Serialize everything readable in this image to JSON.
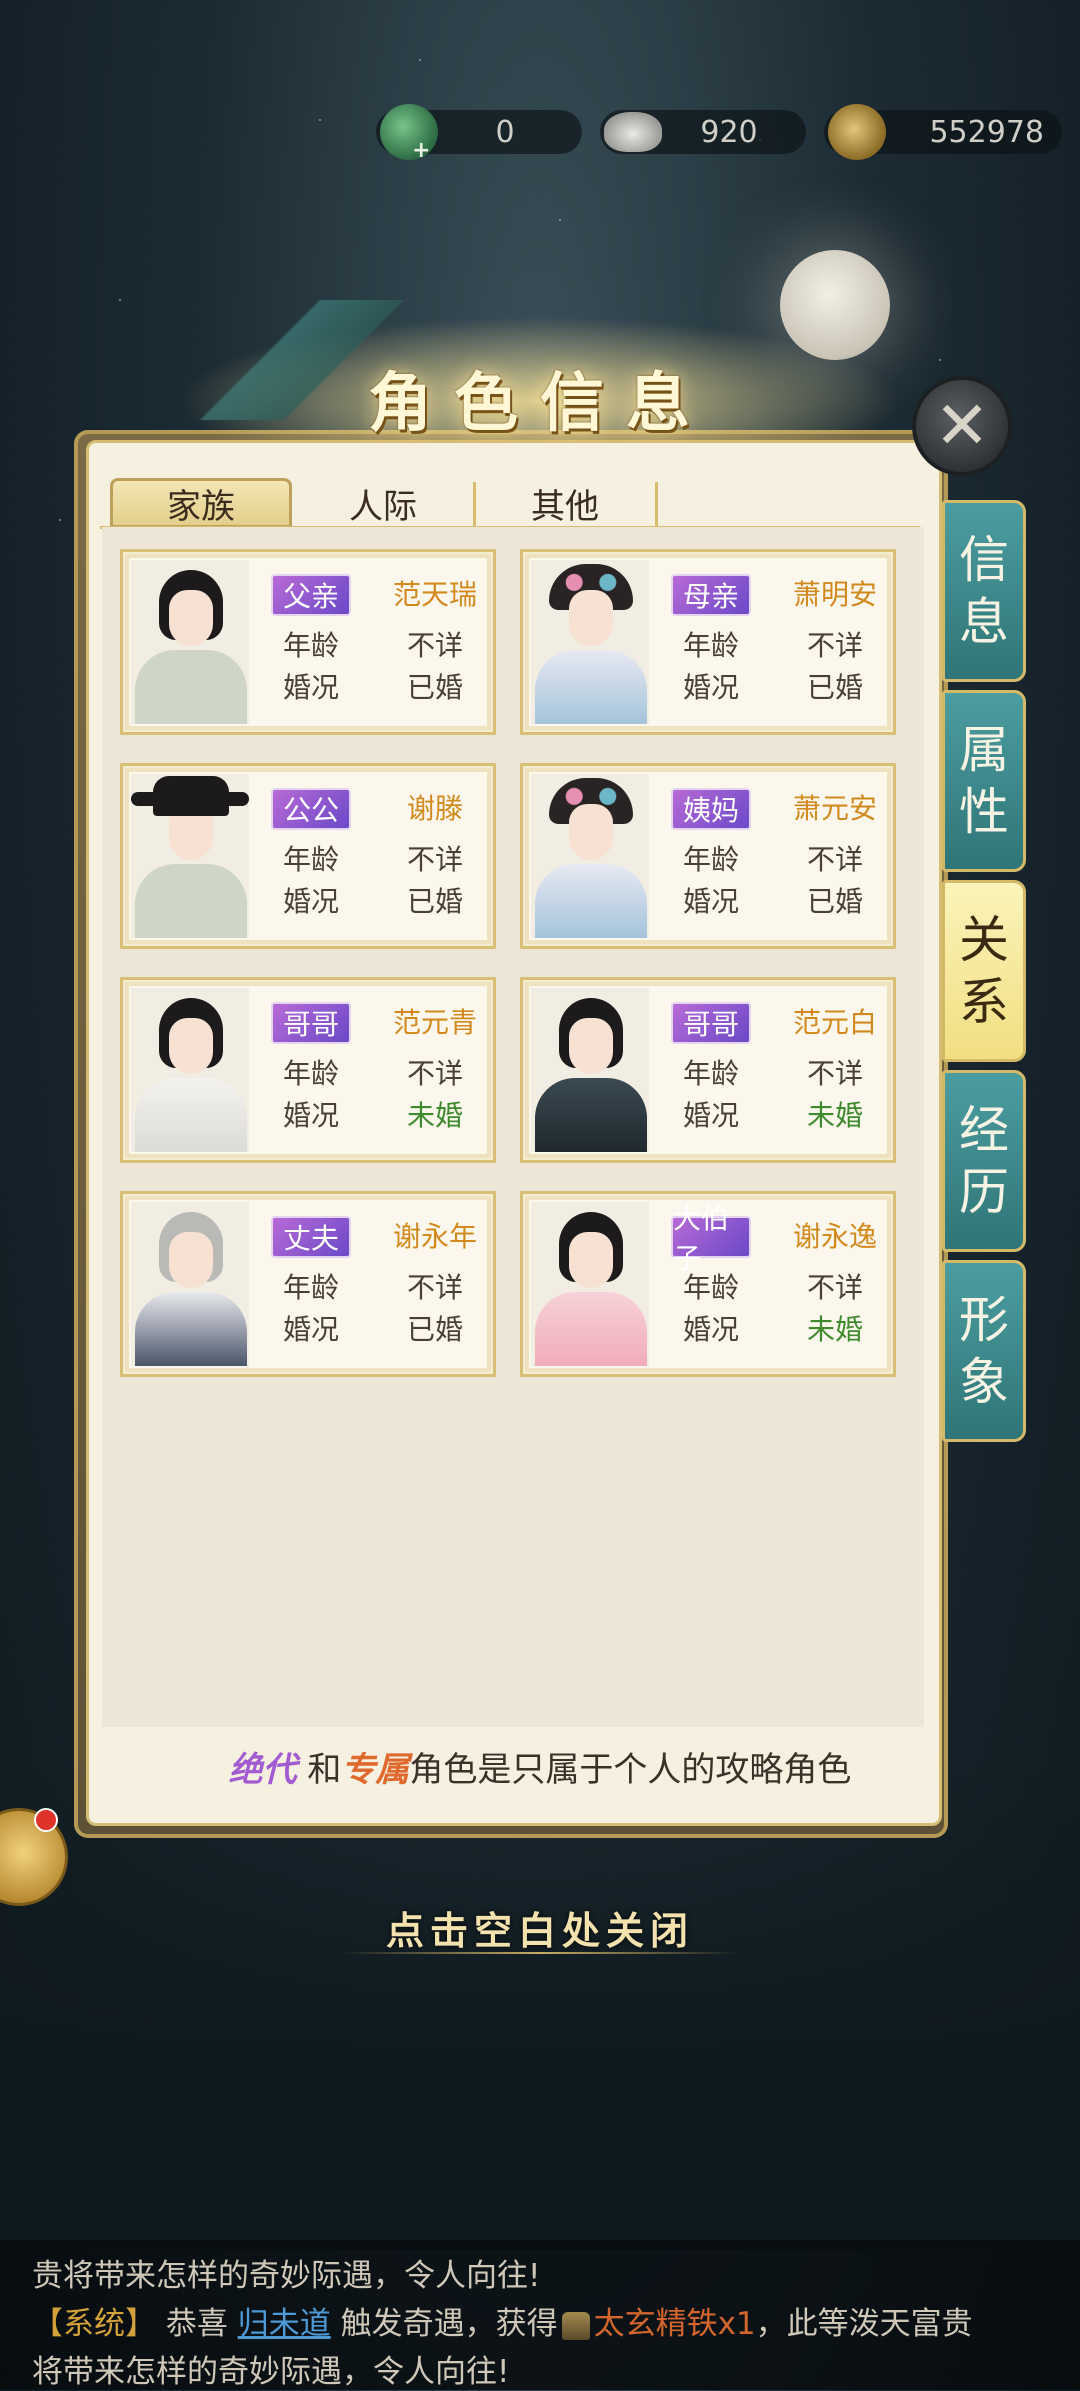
{
  "currency": {
    "jade": "0",
    "silver": "920",
    "copper": "552978"
  },
  "dialog": {
    "title": "角色信息",
    "tabs": [
      "家族",
      "人际",
      "其他"
    ],
    "side_tabs": [
      {
        "label_top": "信",
        "label_bottom": "息"
      },
      {
        "label_top": "属",
        "label_bottom": "性"
      },
      {
        "label_top": "关",
        "label_bottom": "系"
      },
      {
        "label_top": "经",
        "label_bottom": "历"
      },
      {
        "label_top": "形",
        "label_bottom": "象"
      }
    ],
    "age_label": "年龄",
    "marriage_label": "婚况",
    "cards": [
      {
        "role": "父亲",
        "name": "范天瑞",
        "age": "不详",
        "marriage": "已婚"
      },
      {
        "role": "母亲",
        "name": "萧明安",
        "age": "不详",
        "marriage": "已婚"
      },
      {
        "role": "公公",
        "name": "谢滕",
        "age": "不详",
        "marriage": "已婚"
      },
      {
        "role": "姨妈",
        "name": "萧元安",
        "age": "不详",
        "marriage": "已婚"
      },
      {
        "role": "哥哥",
        "name": "范元青",
        "age": "不详",
        "marriage": "未婚"
      },
      {
        "role": "哥哥",
        "name": "范元白",
        "age": "不详",
        "marriage": "未婚"
      },
      {
        "role": "丈夫",
        "name": "谢永年",
        "age": "不详",
        "marriage": "已婚"
      },
      {
        "role": "大伯子",
        "name": "谢永逸",
        "age": "不详",
        "marriage": "未婚"
      }
    ],
    "footer": {
      "tag1": "绝代",
      "and": "和",
      "tag2": "专属",
      "rest": "角色是只属于个人的攻略角色"
    },
    "close_hint": "点击空白处关闭"
  },
  "messages": {
    "line1": "贵将带来怎样的奇妙际遇，令人向往!",
    "sys_tag": "【系统】",
    "congrats": "恭喜",
    "player": "归未道",
    "trigger": "触发奇遇，获得",
    "item": "太玄精铁x1",
    "tail": "，此等泼天富贵",
    "line3": "将带来怎样的奇妙际遇，令人向往!"
  },
  "colors": {
    "side_tab": "#3f8c8f",
    "side_tab_active": "#f5e89a",
    "name_gold": "#d28a1e",
    "unmarried_green": "#3f8a2c"
  }
}
